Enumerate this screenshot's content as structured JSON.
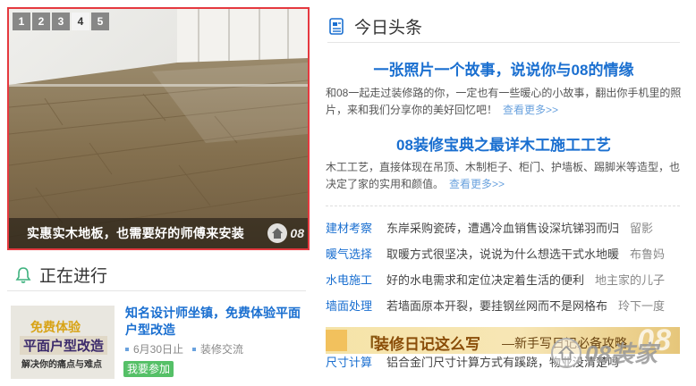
{
  "slideshow": {
    "slides": [
      "1",
      "2",
      "3",
      "4",
      "5"
    ],
    "active_slide": "4",
    "caption": "实惠实木地板，也需要好的师傅来安装",
    "watermark": "08"
  },
  "news": {
    "title": "今日头条",
    "headline_1": "一张照片一个故事，说说你与08的情缘",
    "summary_1": "和08一起走过装修路的你，一定也有一些暖心的小故事，翻出你手机里的照片，来和我们分享你的美好回忆吧！",
    "more_1": "查看更多>>",
    "headline_2": "08装修宝典之最详木工施工工艺",
    "summary_2": "木工工艺，直接体现在吊顶、木制柜子、柜门、护墙板、踢脚米等造型，也决定了家的实用和颜值。",
    "more_2": "查看更多>>",
    "categories": [
      {
        "name": "建材考察",
        "title": "东岸采购瓷砖，遭遇冷血销售设深坑锑羽而归",
        "extra": "留影"
      },
      {
        "name": "暖气选择",
        "title": "取暖方式很坚决，说说为什么想选干式水地暖",
        "extra": "布鲁妈"
      },
      {
        "name": "水电施工",
        "title": "好的水电需求和定位决定着生活的便利",
        "extra": "地主家的儿子"
      },
      {
        "name": "墙面处理",
        "title": "若墙面原本开裂，要挂钢丝网而不是网格布",
        "extra": "玲下一度"
      },
      {
        "name": "尺寸计算",
        "title": "铝合金门尺寸计算方式有蹊跷，物业没清楚吗",
        "extra": ""
      }
    ]
  },
  "banner": {
    "bracket": "「",
    "title": "装修日记这么写",
    "subtitle": "—新手写日记必备攻略",
    "watermark": "08"
  },
  "ongoing": {
    "title": "正在进行",
    "event": {
      "thumb_line1": "免费体验",
      "thumb_line2": "平面户型改造",
      "thumb_line3": "解决你的痛点与难点",
      "title": "知名设计师坐镇，免费体验平面户型改造",
      "date": "6月30日止",
      "tag": "装修交流",
      "join_label": "我要参加"
    }
  },
  "corner_watermark": {
    "text": "08装家"
  },
  "colors": {
    "accent_blue": "#1a6fd0",
    "slideshow_border": "#e5393f",
    "join_green": "#55c067"
  }
}
